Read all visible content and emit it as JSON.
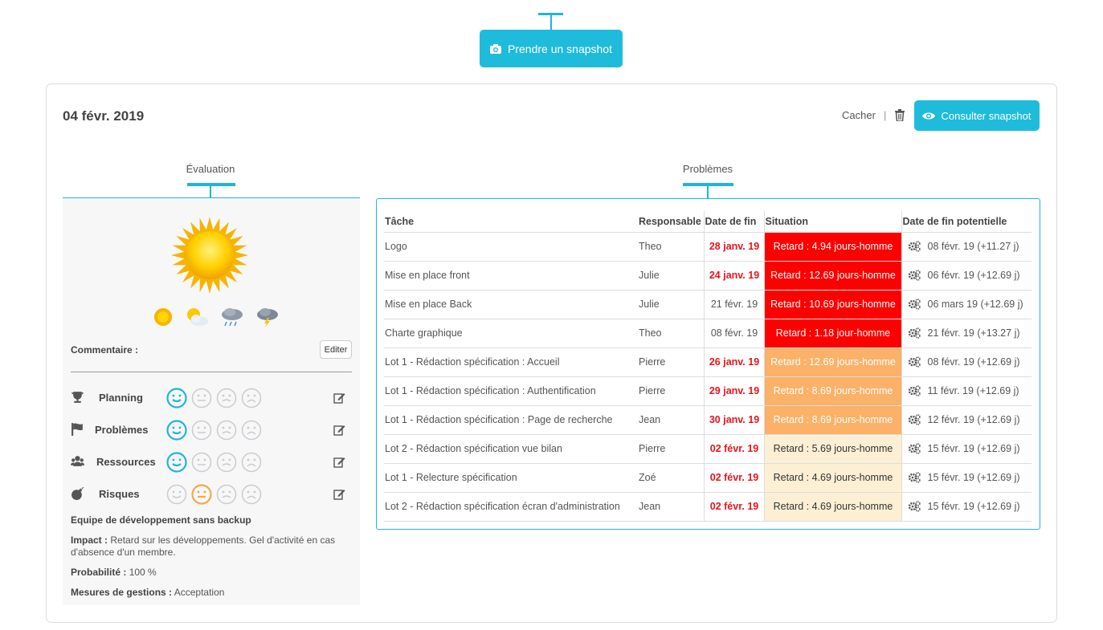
{
  "header": {
    "snapshot_button": "Prendre un snapshot",
    "snapshot_icon": "camera-icon"
  },
  "card": {
    "date": "04 févr. 2019",
    "hide_label": "Cacher",
    "separator": "|",
    "delete_icon": "trash-icon",
    "consult_button": "Consulter snapshot",
    "consult_icon": "eye-icon"
  },
  "evaluation": {
    "title": "Évaluation",
    "current_weather": "sunny",
    "weather_options": [
      "sunny",
      "partly-cloudy",
      "rain",
      "storm"
    ],
    "comment_label": "Commentaire :",
    "edit_label": "Editer",
    "criteria": [
      {
        "icon": "trophy-icon",
        "label": "Planning",
        "level": 1,
        "level_color": "#1fb5d9"
      },
      {
        "icon": "flag-icon",
        "label": "Problèmes",
        "level": 1,
        "level_color": "#1fb5d9"
      },
      {
        "icon": "users-icon",
        "label": "Ressources",
        "level": 1,
        "level_color": "#1fb5d9"
      },
      {
        "icon": "bomb-icon",
        "label": "Risques",
        "level": 2,
        "level_color": "#f5a84a"
      }
    ],
    "risk": {
      "title": "Equipe de développement sans backup",
      "impact_label": "Impact :",
      "impact_value": "Retard sur les développements. Gel d'activité en cas",
      "impact_value_2": "d'absence d'un membre.",
      "probability_label": "Probabilité :",
      "probability_value": "100 %",
      "measures_label": "Mesures de gestions :",
      "measures_value": "Acceptation"
    }
  },
  "problems": {
    "title": "Problèmes",
    "columns": [
      "Tâche",
      "Responsable",
      "Date de fin",
      "Situation",
      "Date de fin potentielle"
    ],
    "rows": [
      {
        "task": "Logo",
        "owner": "Theo",
        "end": "28 janv. 19",
        "end_late": true,
        "situation": "Retard : 4.94 jours-homme",
        "level": "red",
        "potential": "08 févr. 19 (+11.27 j)"
      },
      {
        "task": "Mise en place front",
        "owner": "Julie",
        "end": "24 janv. 19",
        "end_late": true,
        "situation": "Retard : 12.69 jours-homme",
        "level": "red",
        "potential": "06 févr. 19 (+12.69 j)"
      },
      {
        "task": "Mise en place Back",
        "owner": "Julie",
        "end": "21 févr. 19",
        "end_late": false,
        "situation": "Retard : 10.69 jours-homme",
        "level": "red",
        "potential": "06 mars 19 (+12.69 j)"
      },
      {
        "task": "Charte graphique",
        "owner": "Theo",
        "end": "08 févr. 19",
        "end_late": false,
        "situation": "Retard : 1.18 jour-homme",
        "level": "red",
        "potential": "21 févr. 19 (+13.27 j)"
      },
      {
        "task": "Lot 1 - Rédaction spécification : Accueil",
        "owner": "Pierre",
        "end": "26 janv. 19",
        "end_late": true,
        "situation": "Retard : 12.69 jours-homme",
        "level": "orange",
        "potential": "08 févr. 19 (+12.69 j)"
      },
      {
        "task": "Lot 1 - Rédaction spécification : Authentification",
        "owner": "Pierre",
        "end": "29 janv. 19",
        "end_late": true,
        "situation": "Retard : 8.69 jours-homme",
        "level": "orange",
        "potential": "11 févr. 19 (+12.69 j)"
      },
      {
        "task": "Lot 1 - Rédaction spécification : Page de recherche",
        "owner": "Jean",
        "end": "30 janv. 19",
        "end_late": true,
        "situation": "Retard : 8.69 jours-homme",
        "level": "orange",
        "potential": "12 févr. 19 (+12.69 j)"
      },
      {
        "task": "Lot 2 - Rédaction spécification vue bilan",
        "owner": "Pierre",
        "end": "02 févr. 19",
        "end_late": true,
        "situation": "Retard : 5.69 jours-homme",
        "level": "light",
        "potential": "15 févr. 19 (+12.69 j)"
      },
      {
        "task": "Lot 1 - Relecture spécification",
        "owner": "Zoé",
        "end": "02 févr. 19",
        "end_late": true,
        "situation": "Retard : 4.69 jours-homme",
        "level": "light",
        "potential": "15 févr. 19 (+12.69 j)"
      },
      {
        "task": "Lot 2 - Rédaction spécification écran d'administration",
        "owner": "Jean",
        "end": "02 févr. 19",
        "end_late": true,
        "situation": "Retard : 4.69 jours-homme",
        "level": "light",
        "potential": "15 févr. 19 (+12.69 j)"
      }
    ],
    "potential_icon": "gears-icon"
  },
  "colors": {
    "accent": "#1fbbdb",
    "late_text": "#e8141c",
    "situation_red": "#fd0000",
    "situation_orange": "#fbb167",
    "situation_light": "#fdefd4"
  }
}
